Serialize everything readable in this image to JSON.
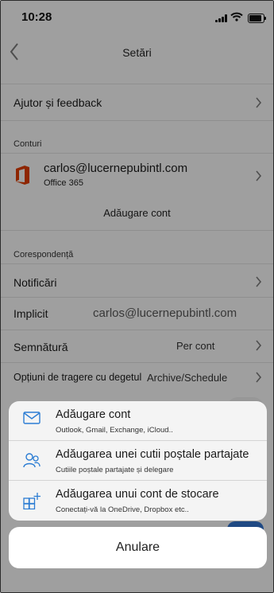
{
  "status_bar": {
    "time": "10:28"
  },
  "nav": {
    "title": "Setări"
  },
  "help_row": {
    "label": "Ajutor și feedback"
  },
  "accounts": {
    "section": "Conturi",
    "email": "carlos@lucernepubintl.com",
    "type": "Office 365",
    "add_label": "Adăugare cont"
  },
  "mail": {
    "section": "Corespondență",
    "notifications": "Notificări",
    "default_label": "Implicit",
    "default_value": "carlos@lucernepubintl.com",
    "signature_label": "Semnătură",
    "signature_value": "Per cont",
    "swipe_label": "Opțiuni de tragere cu degetul",
    "swipe_value": "Archive/Schedule"
  },
  "action_sheet": {
    "options": [
      {
        "title": "Adăugare cont",
        "subtitle": "Outlook, Gmail, Exchange, iCloud..",
        "icon": "mail-icon"
      },
      {
        "title": "Adăugarea unei cutii poștale partajate",
        "subtitle": "Cutiile poștale partajate și delegare",
        "icon": "people-icon"
      },
      {
        "title": "Adăugarea unui cont de stocare",
        "subtitle": "Conectați-vă la OneDrive, Dropbox etc..",
        "icon": "storage-grid-icon"
      }
    ],
    "cancel": "Anulare"
  },
  "colors": {
    "accent": "#2b7cd3",
    "office_red": "#d83b01",
    "toggle_on": "#2f6fc7"
  }
}
